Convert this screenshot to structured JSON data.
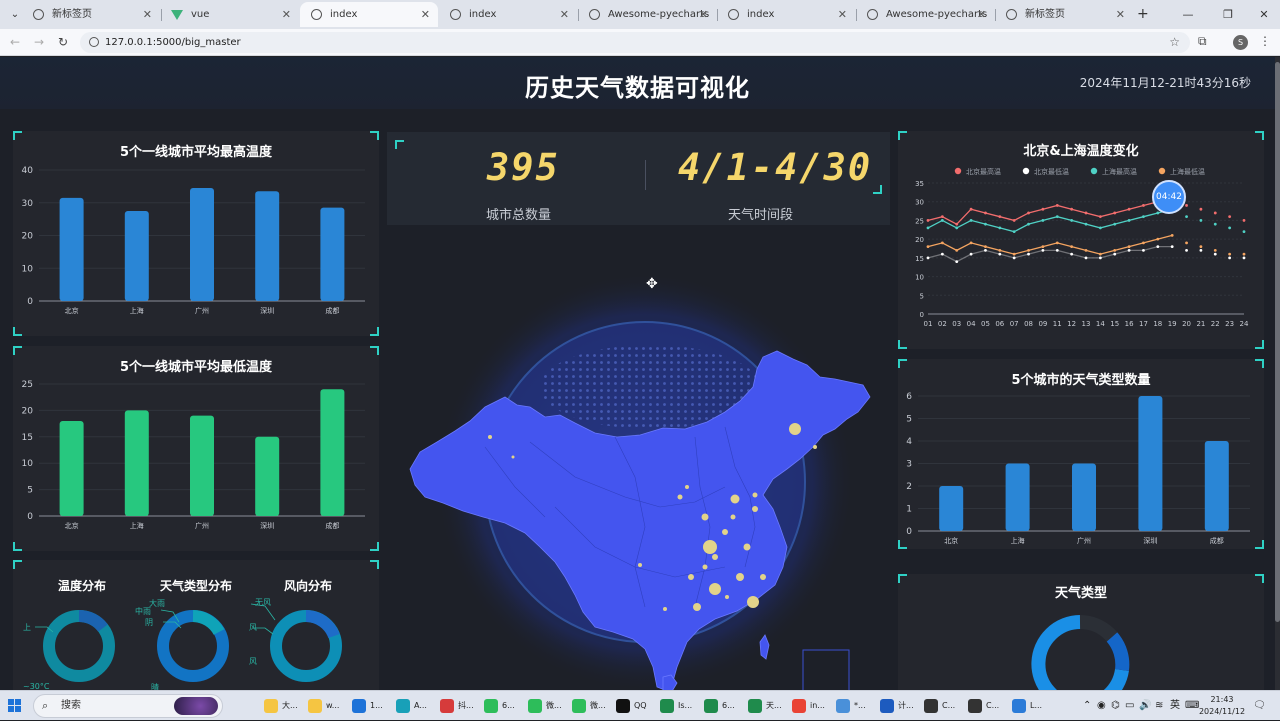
{
  "browser": {
    "tabs": [
      {
        "label": "新标签页",
        "icon": "globe-icon",
        "active": false
      },
      {
        "label": "vue",
        "icon": "vue-logo-icon",
        "active": false
      },
      {
        "label": "index",
        "icon": "globe-icon",
        "active": true
      },
      {
        "label": "index",
        "icon": "globe-icon",
        "active": false
      },
      {
        "label": "Awesome-pyecharts",
        "icon": "globe-icon",
        "active": false
      },
      {
        "label": "index",
        "icon": "globe-icon",
        "active": false
      },
      {
        "label": "Awesome-pyecharts",
        "icon": "globe-icon",
        "active": false
      },
      {
        "label": "新标签页",
        "icon": "globe-icon",
        "active": false
      }
    ],
    "url": "127.0.0.1:5000/big_master",
    "profile_initial": "S"
  },
  "dashboard": {
    "title": "历史天气数据可视化",
    "datetime": "2024年11月12-21时43分16秒",
    "time_badge": "04:42",
    "kpi": {
      "city_count": "395",
      "city_count_label": "城市总数量",
      "period": "4/1-4/30",
      "period_label": "天气时间段"
    },
    "panels": {
      "avg_high": "5个一线城市平均最高温度",
      "avg_low": "5个一线城市平均最低温度",
      "temp_dist": "温度分布",
      "weather_dist": "天气类型分布",
      "wind_dist": "风向分布",
      "bj_sh": "北京&上海温度变化",
      "weather_count": "5个城市的天气类型数量",
      "weather_type": "天气类型"
    },
    "donut_labels": {
      "temp": [
        "上",
        "~30°C"
      ],
      "weather": [
        "大雨",
        "中雨",
        "阴",
        "晴"
      ],
      "wind": [
        "无风",
        "风",
        "风"
      ]
    }
  },
  "chart_data": [
    {
      "type": "bar",
      "title": "5个一线城市平均最高温度",
      "categories": [
        "北京",
        "上海",
        "广州",
        "深圳",
        "成都"
      ],
      "values": [
        31.5,
        27.5,
        34.5,
        33.5,
        28.5
      ],
      "ylim": [
        0,
        40
      ],
      "yticks": [
        0,
        10,
        20,
        30,
        40
      ],
      "color": "#2a86d6"
    },
    {
      "type": "bar",
      "title": "5个一线城市平均最低温度",
      "categories": [
        "北京",
        "上海",
        "广州",
        "深圳",
        "成都"
      ],
      "values": [
        18,
        20,
        19,
        15,
        24
      ],
      "ylim": [
        0,
        25
      ],
      "yticks": [
        0,
        5,
        10,
        15,
        20,
        25
      ],
      "color": "#27c87f"
    },
    {
      "type": "line",
      "title": "北京&上海温度变化",
      "x": [
        "01",
        "02",
        "03",
        "04",
        "05",
        "06",
        "07",
        "08",
        "09",
        "11",
        "12",
        "13",
        "14",
        "15",
        "16",
        "17",
        "18",
        "19",
        "20",
        "21",
        "22",
        "23",
        "24"
      ],
      "ylim": [
        0,
        35
      ],
      "yticks": [
        0,
        5,
        10,
        15,
        20,
        25,
        30,
        35
      ],
      "series": [
        {
          "name": "北京最高温",
          "color": "#f26d6d",
          "values": [
            25,
            26,
            24,
            28,
            27,
            26,
            25,
            27,
            28,
            29,
            28,
            27,
            26,
            27,
            28,
            29,
            30,
            31,
            29,
            28,
            27,
            26,
            25
          ]
        },
        {
          "name": "北京最低温",
          "color": "#ffffff",
          "values": [
            15,
            16,
            14,
            16,
            17,
            16,
            15,
            16,
            17,
            17,
            16,
            15,
            15,
            16,
            17,
            17,
            18,
            18,
            17,
            17,
            16,
            15,
            15
          ]
        },
        {
          "name": "上海最高温",
          "color": "#4fd1c5",
          "values": [
            23,
            25,
            23,
            25,
            24,
            23,
            22,
            24,
            25,
            26,
            25,
            24,
            23,
            24,
            25,
            26,
            27,
            28,
            26,
            25,
            24,
            23,
            22
          ]
        },
        {
          "name": "上海最低温",
          "color": "#f4a460",
          "values": [
            18,
            19,
            17,
            19,
            18,
            17,
            16,
            17,
            18,
            19,
            18,
            17,
            16,
            17,
            18,
            19,
            20,
            21,
            19,
            18,
            17,
            16,
            16
          ]
        }
      ]
    },
    {
      "type": "bar",
      "title": "5个城市的天气类型数量",
      "categories": [
        "北京",
        "上海",
        "广州",
        "深圳",
        "成都"
      ],
      "values": [
        2,
        3,
        3,
        6,
        4
      ],
      "ylim": [
        0,
        6
      ],
      "yticks": [
        0,
        1,
        2,
        3,
        4,
        5,
        6
      ],
      "color": "#2a86d6"
    }
  ],
  "taskbar": {
    "search_placeholder": "搜索",
    "items": [
      "大...",
      "w...",
      "1...",
      "A...",
      "抖...",
      "6...",
      "微...",
      "微...",
      "QQ",
      "Is...",
      "6...",
      "天...",
      "in...",
      "*...",
      "计...",
      "C...",
      "C...",
      "L..."
    ],
    "ime": "英",
    "time": "21:43",
    "date": "2024/11/12"
  }
}
